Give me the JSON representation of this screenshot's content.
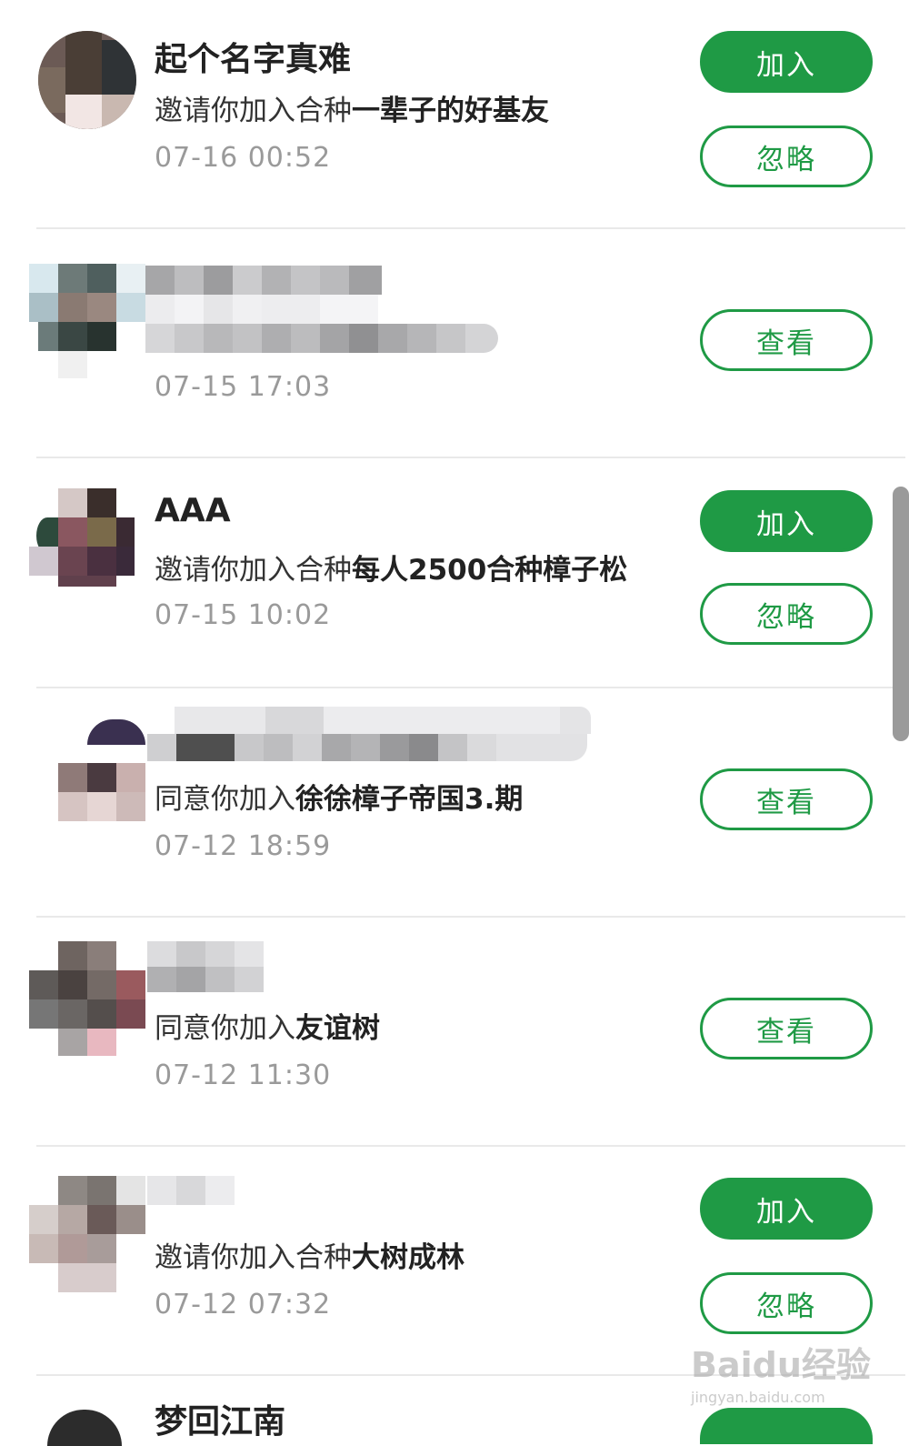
{
  "items": [
    {
      "name": "起个名字真难",
      "prefix": "邀请你加入合种",
      "group": "一辈子的好基友",
      "time": "07-16 00:52",
      "buttons": [
        "加入",
        "忽略"
      ]
    },
    {
      "name": "",
      "prefix": "",
      "group": "",
      "time": "07-15 17:03",
      "buttons": [
        "查看"
      ]
    },
    {
      "name": "AAA",
      "prefix": "邀请你加入合种",
      "group": "每人2500合种樟子松",
      "time": "07-15 10:02",
      "buttons": [
        "加入",
        "忽略"
      ]
    },
    {
      "name": "",
      "prefix": "同意你加入",
      "group": "徐徐樟子帝国3.期",
      "time": "07-12 18:59",
      "buttons": [
        "查看"
      ]
    },
    {
      "name": "",
      "prefix": "同意你加入",
      "group": "友谊树",
      "time": "07-12 11:30",
      "buttons": [
        "查看"
      ]
    },
    {
      "name": "",
      "prefix": "邀请你加入合种",
      "group": "大树成林",
      "time": "07-12 07:32",
      "buttons": [
        "加入",
        "忽略"
      ]
    }
  ],
  "partial_item": {
    "name": "梦回江南"
  },
  "watermark": {
    "brand": "Baidu经验",
    "url": "jingyan.baidu.com"
  },
  "colors": {
    "primary": "#1f9a45",
    "text": "#222222",
    "muted": "#9a9a9a"
  }
}
